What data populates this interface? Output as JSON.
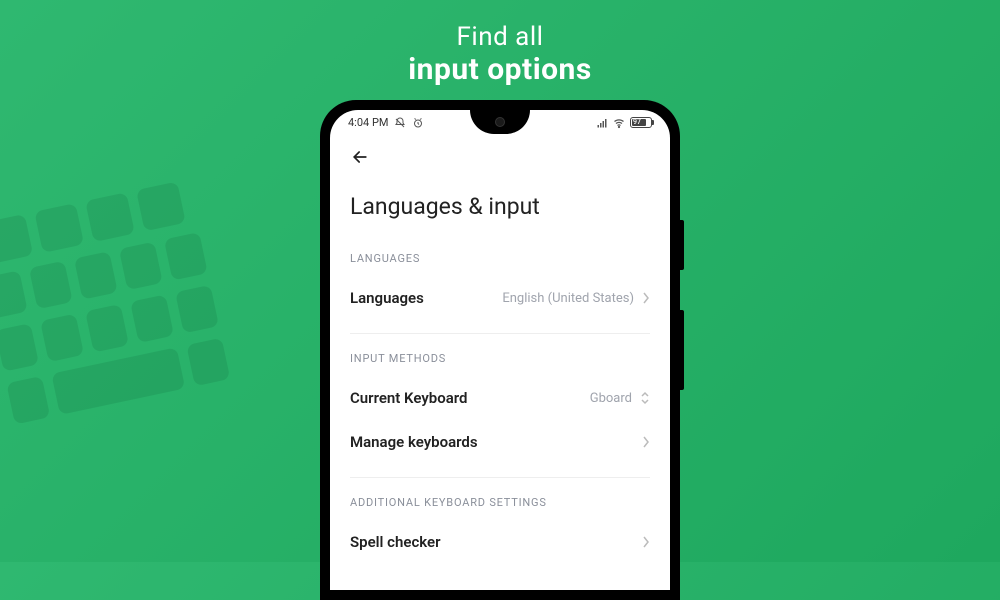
{
  "heading": {
    "line1": "Find all",
    "line2": "input options"
  },
  "status": {
    "time": "4:04 PM",
    "battery_text": "97"
  },
  "page": {
    "title": "Languages & input"
  },
  "sections": {
    "languages": {
      "header": "LANGUAGES",
      "items": {
        "languages": {
          "label": "Languages",
          "value": "English (United States)"
        }
      }
    },
    "input_methods": {
      "header": "INPUT METHODS",
      "items": {
        "current_keyboard": {
          "label": "Current Keyboard",
          "value": "Gboard"
        },
        "manage_keyboards": {
          "label": "Manage keyboards"
        }
      }
    },
    "additional": {
      "header": "ADDITIONAL KEYBOARD SETTINGS",
      "items": {
        "spell_checker": {
          "label": "Spell checker"
        }
      }
    }
  }
}
